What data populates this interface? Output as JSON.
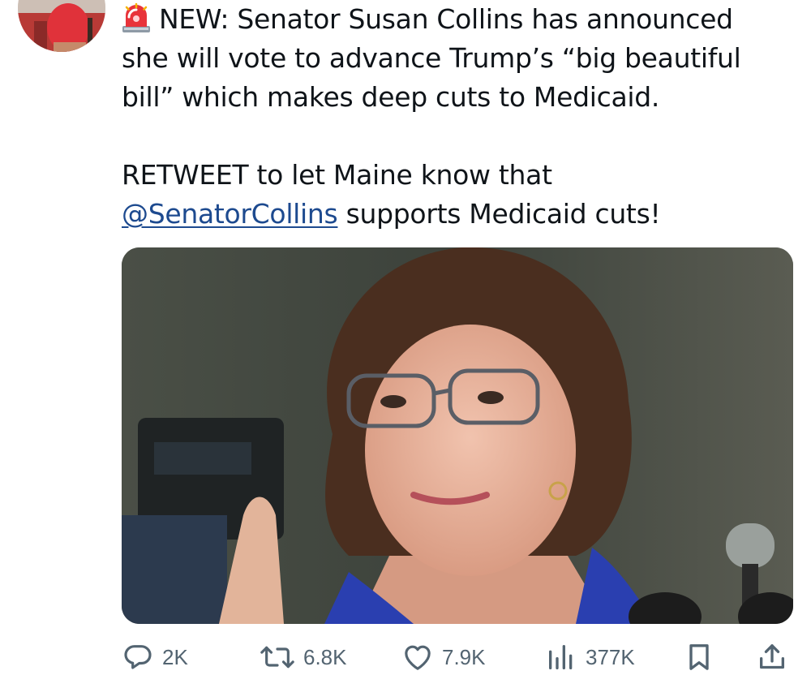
{
  "tweet": {
    "line1_prefix": "NEW: Senator Susan Collins has announced",
    "line2": "she will vote to advance Trump’s “big beautiful",
    "line3": "bill” which makes deep cuts to Medicaid.",
    "line4": "RETWEET to let Maine know that",
    "mention": "@SenatorCollins",
    "line5_suffix": " supports Medicaid cuts!",
    "siren_icon": "rotating-light-emoji"
  },
  "actions": {
    "replies": "2K",
    "reposts": "6.8K",
    "likes": "7.9K",
    "views": "377K"
  },
  "colors": {
    "text": "#0f1419",
    "action_gray": "#536471",
    "mention": "#1d4a8f"
  }
}
